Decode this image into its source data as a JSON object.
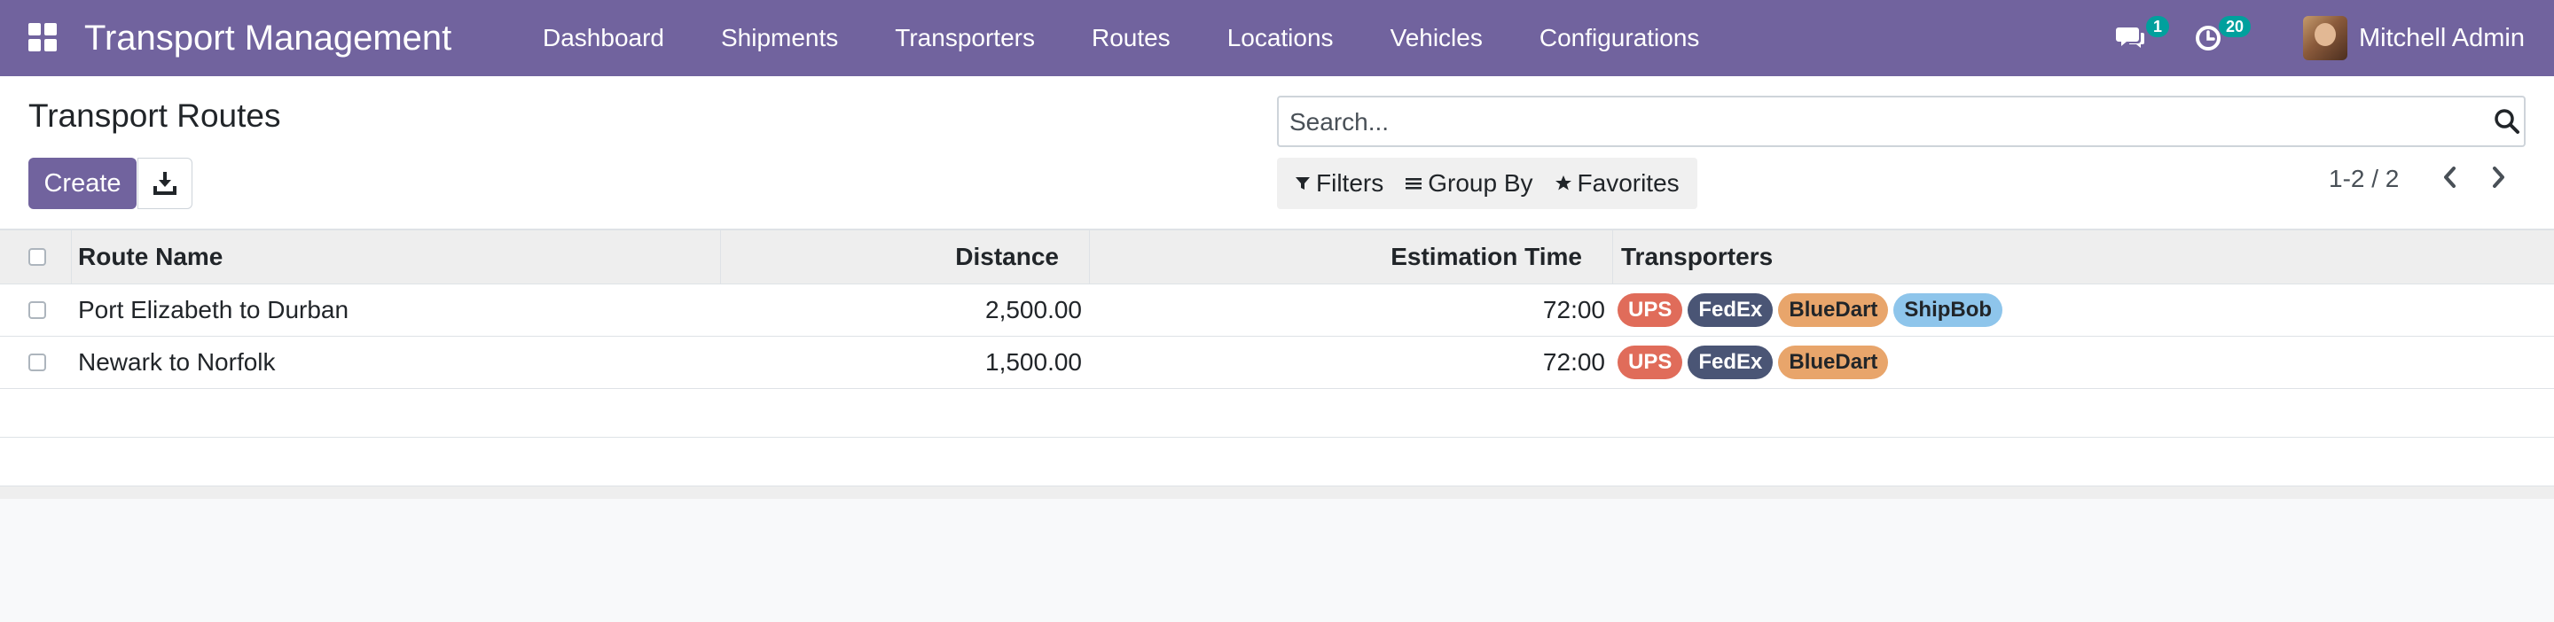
{
  "app": {
    "title": "Transport Management",
    "menu": [
      "Dashboard",
      "Shipments",
      "Transporters",
      "Routes",
      "Locations",
      "Vehicles",
      "Configurations"
    ],
    "messages_count": "1",
    "activities_count": "20",
    "user_name": "Mitchell Admin"
  },
  "control_panel": {
    "title": "Transport Routes",
    "create_label": "Create",
    "search_placeholder": "Search...",
    "filters_label": "Filters",
    "group_by_label": "Group By",
    "favorites_label": "Favorites",
    "pager": "1-2 / 2"
  },
  "table": {
    "headers": {
      "route_name": "Route Name",
      "distance": "Distance",
      "estimation_time": "Estimation Time",
      "transporters": "Transporters"
    },
    "rows": [
      {
        "route_name": "Port Elizabeth to Durban",
        "distance": "2,500.00",
        "estimation_time": "72:00",
        "tags": [
          "UPS",
          "FedEx",
          "BlueDart",
          "ShipBob"
        ]
      },
      {
        "route_name": "Newark to Norfolk",
        "distance": "1,500.00",
        "estimation_time": "72:00",
        "tags": [
          "UPS",
          "FedEx",
          "BlueDart"
        ]
      }
    ]
  },
  "tag_colors": {
    "UPS": {
      "bg": "#e06c5a",
      "fg": "#ffffff"
    },
    "FedEx": {
      "bg": "#4a5575",
      "fg": "#ffffff"
    },
    "BlueDart": {
      "bg": "#e8a56b",
      "fg": "#212529"
    },
    "ShipBob": {
      "bg": "#8ec5eb",
      "fg": "#212529"
    }
  },
  "colors": {
    "brand": "#71639e",
    "badge": "#00a09d"
  }
}
